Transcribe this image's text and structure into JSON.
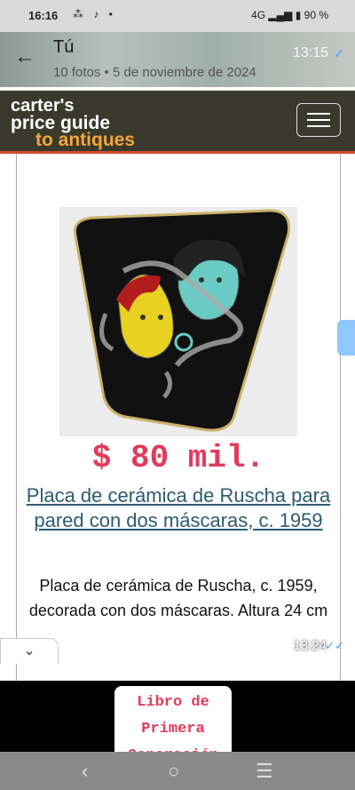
{
  "status_bar": {
    "time": "16:16",
    "notification_icons": "⁂ ♪ •",
    "signal": "4G",
    "battery": "90 %"
  },
  "chat_header": {
    "title": "Tú",
    "subtitle": "10 fotos  •  5 de noviembre de 2024",
    "time": "13:15"
  },
  "site": {
    "logo_line1": "carter's",
    "logo_line2": "price guide",
    "logo_line3": "to antiques"
  },
  "item": {
    "price": "$ 80 mil.",
    "title": "Placa de cerámica de Ruscha para pared con dos máscaras, c. 1959",
    "description": "Placa de cerámica de Ruscha, c. 1959, decorada con dos máscaras. Altura 24 cm"
  },
  "message_time": "13:24",
  "next_card": {
    "line1": "Libro de",
    "line2": "Primera",
    "line3": "Generación"
  },
  "colors": {
    "price": "#e23b5c",
    "link": "#2d5b72",
    "nav_bg": "#3a3a2c",
    "logo_accent": "#f4a63a"
  }
}
